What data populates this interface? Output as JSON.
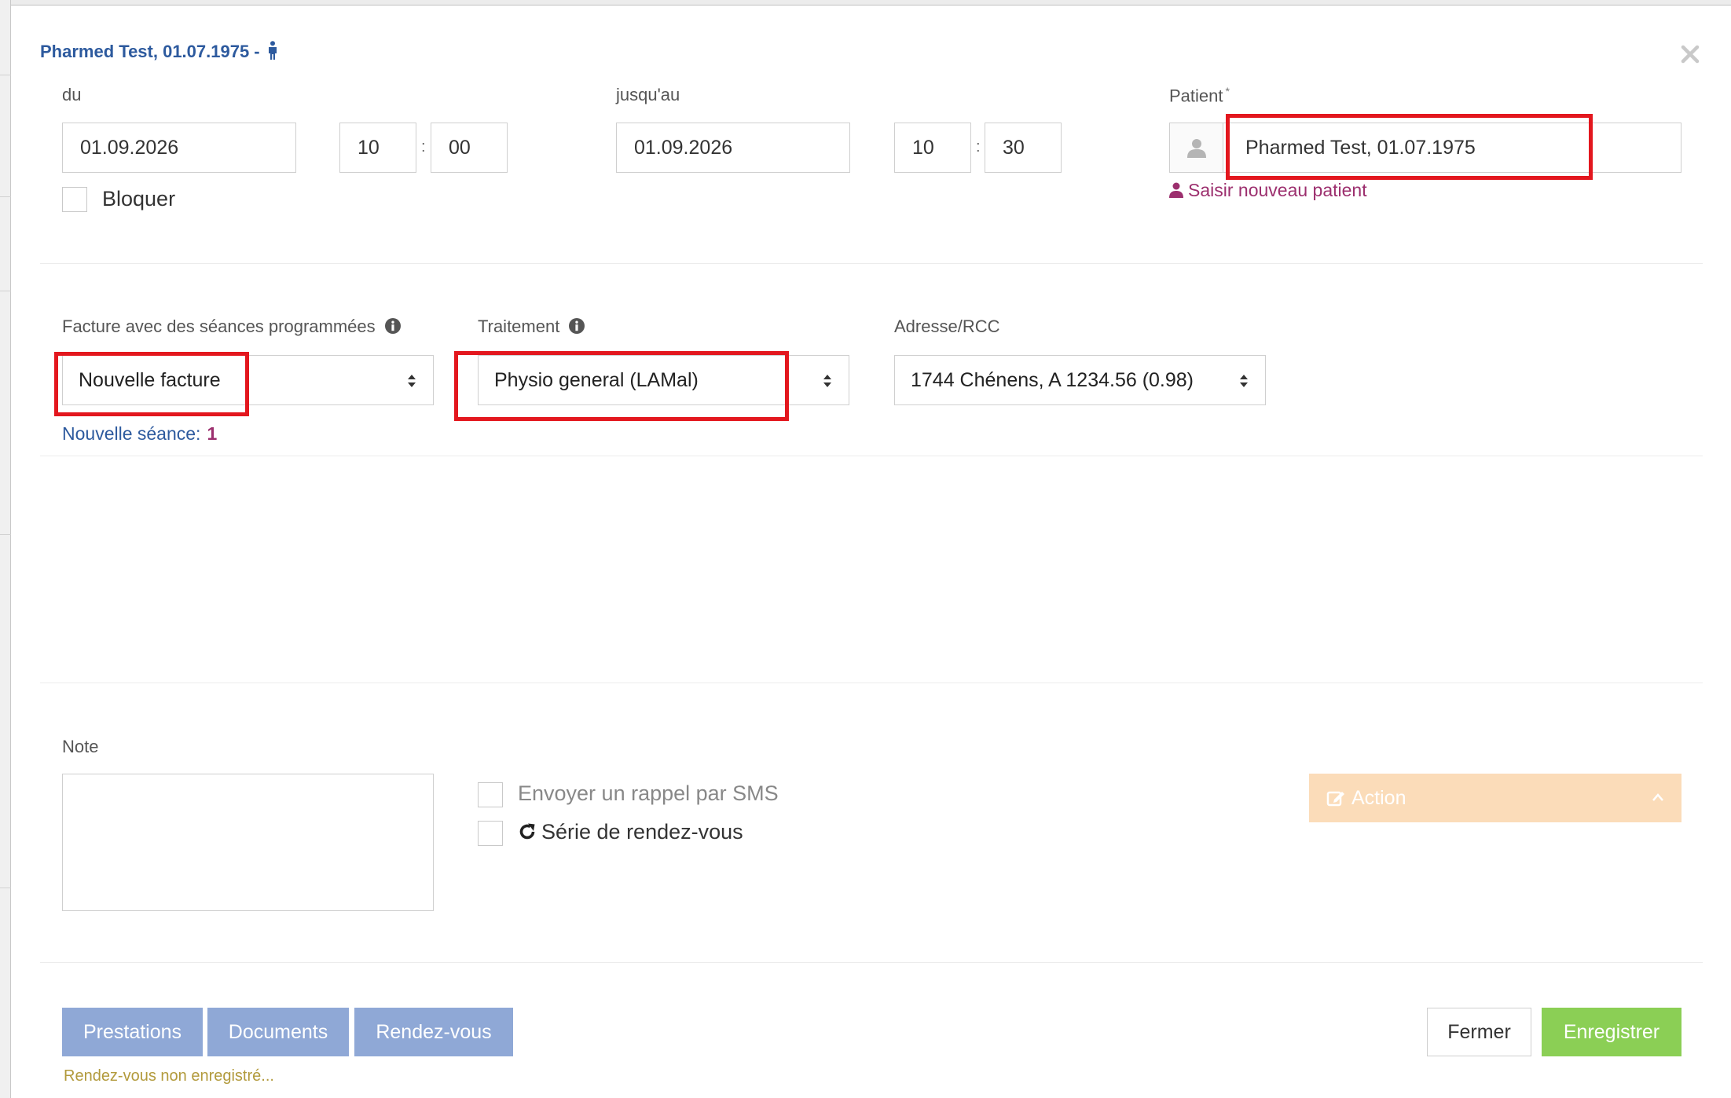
{
  "header": {
    "title": "Pharmed Test, 01.07.1975 -",
    "title_icon": "male-person-icon",
    "close_icon": "close-icon"
  },
  "appointment": {
    "from_label": "du",
    "from_date": "01.09.2026",
    "from_hour": "10",
    "from_minute": "00",
    "to_label": "jusqu'au",
    "to_date": "01.09.2026",
    "to_hour": "10",
    "to_minute": "30",
    "time_separator": ":",
    "block_label": "Bloquer",
    "block_checked": false
  },
  "patient": {
    "label": "Patient",
    "required_mark": "*",
    "value": "Pharmed Test, 01.07.1975",
    "new_patient_link": "Saisir nouveau patient",
    "link_color": "#9c2f6e"
  },
  "billing": {
    "invoice_label": "Facture avec des séances programmées",
    "invoice_value": "Nouvelle facture",
    "treatment_label": "Traitement",
    "treatment_value": "Physio general (LAMal)",
    "address_label": "Adresse/RCC",
    "address_value": "1744 Chénens, A 1234.56 (0.98)",
    "session_label": "Nouvelle séance:",
    "session_count": "1"
  },
  "note": {
    "label": "Note",
    "value": ""
  },
  "options": {
    "sms_label": "Envoyer un rappel par SMS",
    "sms_checked": false,
    "series_label": "Série de rendez-vous",
    "series_checked": false
  },
  "action": {
    "label": "Action",
    "color": "#fbdcb9"
  },
  "footer": {
    "tabs": [
      "Prestations",
      "Documents",
      "Rendez-vous"
    ],
    "close_label": "Fermer",
    "save_label": "Enregistrer",
    "status": "Rendez-vous non enregistré...",
    "tab_color": "#8fa8d6",
    "save_color": "#8bcf55"
  },
  "colors": {
    "highlight": "#e3171e",
    "title": "#2d5a9e"
  }
}
